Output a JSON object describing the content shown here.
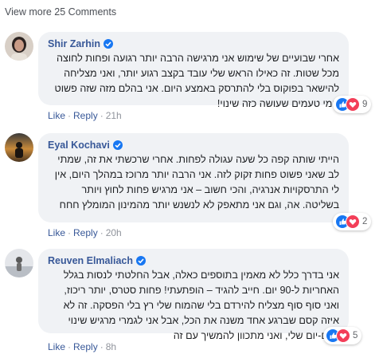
{
  "view_more": "View more 25 Comments",
  "comments": [
    {
      "author": "Shir Zarhin",
      "text": "אחרי שבועיים של שימוש אני מרגישה הרבה יותר רגועה ופחות לחוצה מכל שטות. זה כאילו הראש שלי עובד בקצב רגוע יותר, ואני מצליחה להישאר בפוקוס בלי להתרסק באמצע היום. אני בהלם מזה שזה פשוט גומי טעמים שעושה כזה שינוי!",
      "like": "Like",
      "reply": "Reply",
      "time": "21h",
      "reaction_count": "9"
    },
    {
      "author": "Eyal Kochavi",
      "text": "הייתי שותה קפה כל שעה עגולה לפחות. אחרי שרכשתי את זה, שמתי לב שאני פשוט פחות זקוק לזה. אני הרבה יותר מרוכז במהלך היום, אין לי התרסקויות אנרגיה, והכי חשוב – אני מרגיש פחות לחוץ ויותר בשליטה. אה, וגם אני מתאפק לא לנשנש יותר מהמינון המומלץ חחח",
      "like": "Like",
      "reply": "Reply",
      "time": "20h",
      "reaction_count": "2"
    },
    {
      "author": "Reuven Elmaliach",
      "text": "אני בדרך כלל לא מאמין בתוספים כאלה, אבל החלטתי לנסות בגלל האחריות ל-90 יום. חייב להגיד – הופתעתי! פחות סטרס, יותר ריכוז, ואני סוף סוף מצליח להירדם בלי שהמוח שלי רץ בלי הפסקה. זה לא איזה קסם שברגע אחד משנה את הכל, אבל אני לגמרי מרגיש שינוי ביום-יום שלי, ואני מתכוון להמשיך עם זה",
      "like": "Like",
      "reply": "Reply",
      "time": "8h",
      "reaction_count": "5"
    }
  ]
}
